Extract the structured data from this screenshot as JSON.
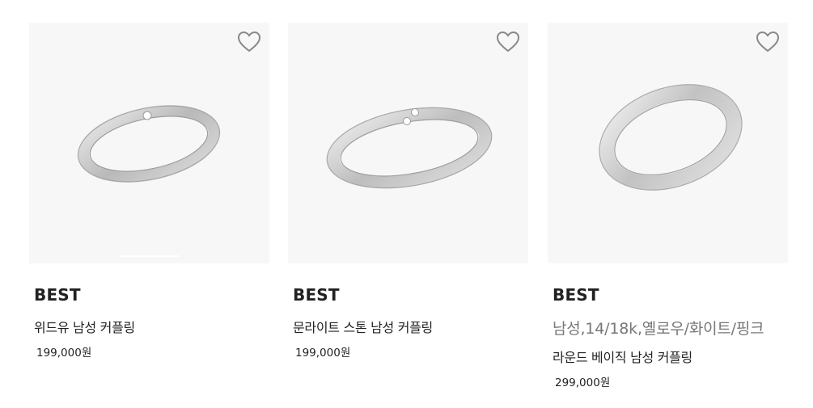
{
  "products": [
    {
      "image_alt": "위드유 남성 커플링",
      "badge": "BEST",
      "subtitle": "",
      "name": "위드유 남성 커플링",
      "price": "199,000원",
      "wishlist_icon": "heart-outline-icon"
    },
    {
      "image_alt": "문라이트 스톤 남성 커플링",
      "badge": "BEST",
      "subtitle": "",
      "name": "문라이트 스톤 남성 커플링",
      "price": "199,000원",
      "wishlist_icon": "heart-outline-icon"
    },
    {
      "image_alt": "라운드 베이직 남성 커플링",
      "badge": "BEST",
      "subtitle": "남성,14/18k,옐로우/화이트/핑크",
      "name": "라운드 베이직 남성 커플링",
      "price": "299,000원",
      "wishlist_icon": "heart-outline-icon"
    }
  ],
  "colors": {
    "thumb_bg": "#f7f7f7",
    "heart_stroke": "#888888",
    "text_primary": "#222222",
    "text_secondary": "#777777"
  }
}
